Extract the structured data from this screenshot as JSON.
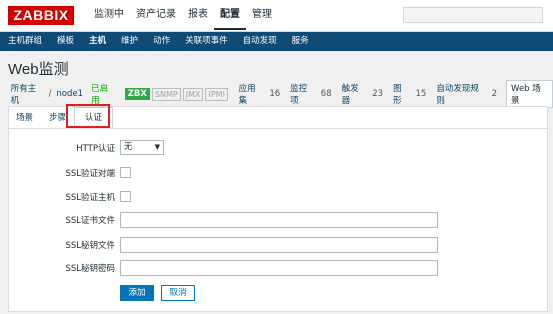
{
  "app": {
    "logo": "ZABBIX"
  },
  "topnav": [
    "监测中",
    "资产记录",
    "报表",
    "配置",
    "管理"
  ],
  "subnav": [
    "主机群组",
    "模板",
    "主机",
    "维护",
    "动作",
    "关联项事件",
    "自动发现",
    "服务"
  ],
  "page_title": "Web监测",
  "breadcrumb": {
    "all_hosts": "所有主机",
    "separator": "/",
    "host": "node1",
    "status": "已启用",
    "availability": [
      "ZBX",
      "SNMP",
      "JMX",
      "IPMI"
    ],
    "links": [
      {
        "label": "应用集",
        "count": "16"
      },
      {
        "label": "监控项",
        "count": "68"
      },
      {
        "label": "触发器",
        "count": "23"
      },
      {
        "label": "图形",
        "count": "15"
      },
      {
        "label": "自动发现规则",
        "count": "2"
      }
    ],
    "current": "Web 场景"
  },
  "tabs": [
    "场景",
    "步骤",
    "认证"
  ],
  "form": {
    "http_auth": {
      "label": "HTTP认证",
      "value": "无"
    },
    "ssl_verify_peer": {
      "label": "SSL验证对端"
    },
    "ssl_verify_host": {
      "label": "SSL验证主机"
    },
    "ssl_cert_file": {
      "label": "SSL证书文件",
      "value": ""
    },
    "ssl_key_file": {
      "label": "SSL秘钥文件",
      "value": ""
    },
    "ssl_key_password": {
      "label": "SSL秘钥密码",
      "value": ""
    }
  },
  "buttons": {
    "add": "添加",
    "cancel": "取消"
  },
  "colors": {
    "brand": "#d40000",
    "subnav": "#0e4b76",
    "primary": "#0275b8",
    "highlight": "#e01c1c",
    "zbx": "#2eaa4a"
  }
}
